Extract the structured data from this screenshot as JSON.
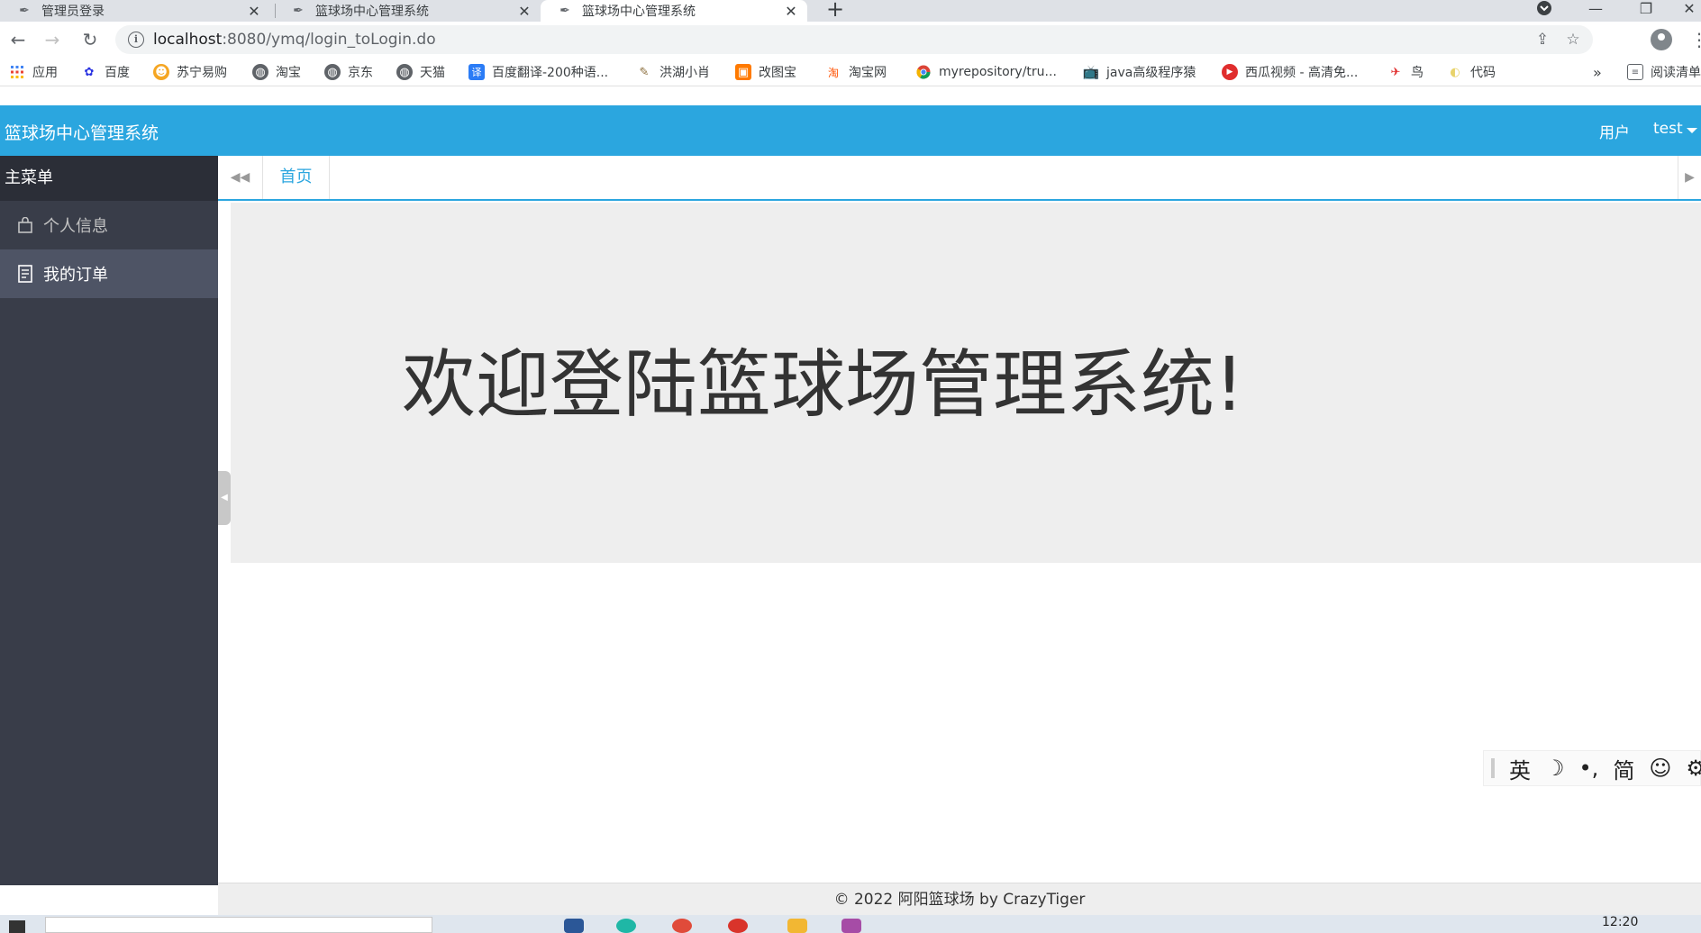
{
  "browser": {
    "tabs": [
      {
        "title": "管理员登录",
        "active": false
      },
      {
        "title": "篮球场中心管理系统",
        "active": false
      },
      {
        "title": "篮球场中心管理系统",
        "active": true
      }
    ],
    "new_tab": "+",
    "url_host": "localhost",
    "url_path": ":8080/ymq/login_toLogin.do",
    "bookmarks": [
      {
        "label": "应用",
        "icon": "apps-grid-icon",
        "color": "#4285f4"
      },
      {
        "label": "百度",
        "icon": "baidu-paw-icon",
        "color": "#2932e1"
      },
      {
        "label": "苏宁易购",
        "icon": "suning-lion-icon",
        "color": "#f5a623"
      },
      {
        "label": "淘宝",
        "icon": "globe-icon",
        "color": "#5f6368"
      },
      {
        "label": "京东",
        "icon": "globe-icon",
        "color": "#5f6368"
      },
      {
        "label": "天猫",
        "icon": "globe-icon",
        "color": "#5f6368"
      },
      {
        "label": "百度翻译-200种语...",
        "icon": "translate-icon",
        "color": "#2b7cf6"
      },
      {
        "label": "洪湖小肖",
        "icon": "feather-icon",
        "color": "#8a6d3b"
      },
      {
        "label": "改图宝",
        "icon": "image-edit-icon",
        "color": "#ff7a00"
      },
      {
        "label": "淘宝网",
        "icon": "taobao-icon",
        "color": "#ff5000"
      },
      {
        "label": "myrepository/tru...",
        "icon": "chrome-icon",
        "color": "#db4437"
      },
      {
        "label": "java高级程序猿",
        "icon": "bilibili-tv-icon",
        "color": "#00a1d6"
      },
      {
        "label": "西瓜视频 - 高清免...",
        "icon": "play-icon",
        "color": "#e02d2d"
      },
      {
        "label": "鸟",
        "icon": "bird-icon",
        "color": "#e02d2d"
      },
      {
        "label": "代码",
        "icon": "moon-icon",
        "color": "#e8d36a"
      }
    ],
    "bookmarks_overflow": "»",
    "reading_list": "阅读清单"
  },
  "app": {
    "title": "篮球场中心管理系统",
    "header_user_label": "用户",
    "header_username": "test"
  },
  "sidebar": {
    "heading": "主菜单",
    "items": [
      {
        "label": "个人信息",
        "icon": "bag-icon",
        "active": false
      },
      {
        "label": "我的订单",
        "icon": "document-icon",
        "active": true
      }
    ]
  },
  "tabbar": {
    "home_label": "首页"
  },
  "main": {
    "welcome": "欢迎登陆篮球场管理系统!"
  },
  "ime": {
    "items": [
      "英",
      "☽",
      "•,",
      "简",
      "☺",
      "⚙"
    ]
  },
  "footer": {
    "text": "© 2022 阿阳篮球场 by CrazyTiger"
  },
  "taskbar": {
    "clock": "12:20"
  },
  "colors": {
    "header": "#2ba6df",
    "sidebar": "#393d49",
    "sidebar_head": "#2b2e37",
    "sidebar_active": "#4e5465",
    "panel": "#eeeeee"
  }
}
